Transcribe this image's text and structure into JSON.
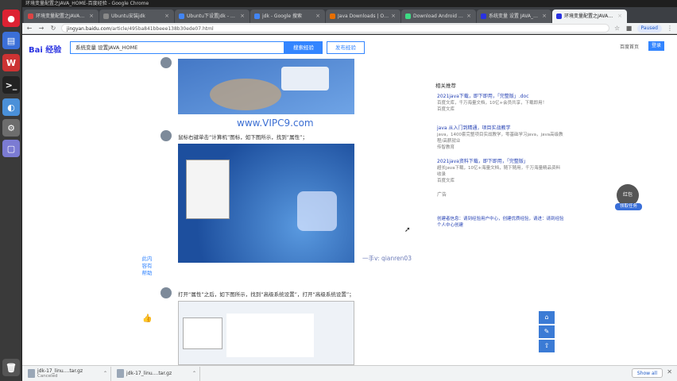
{
  "topbar": {
    "title": "环境变量配置之JAVA_HOME-百度经验 - Google Chrome",
    "clock": ""
  },
  "tabs": [
    {
      "label": "环境变量配置之JAVA_HOME-百度经验",
      "color": "#d44"
    },
    {
      "label": "Ubuntu安装jdk",
      "color": "#888"
    },
    {
      "label": "Ubuntu下设置jdk - Google",
      "color": "#4285f4"
    },
    {
      "label": "jdk - Google 搜索",
      "color": "#4285f4"
    },
    {
      "label": "Java Downloads | Oracle",
      "color": "#e76f00"
    },
    {
      "label": "Download Android Studio",
      "color": "#3ddc84"
    },
    {
      "label": "系统变量 设置 JAVA_HOME",
      "color": "#2932e1"
    },
    {
      "label": "环境变量配置之JAVA_HOME",
      "color": "#2932e1",
      "active": true
    }
  ],
  "address": {
    "host": "jingyan.baidu.com",
    "path": "/article/495ba841bbeee138b30ede07.html"
  },
  "paused_label": "Paused",
  "baidu": {
    "logo": "Bai 经验",
    "search_value": "系统变量 设置JAVA_HOME",
    "search_btn": "搜索经验",
    "publish_btn": "发布经验",
    "home_link": "百度首页",
    "login_btn": "登录"
  },
  "article": {
    "watermark": "www.VIPC9.com",
    "step2": "鼠标右键单击“计算机”图标，如下图所示，找到“属性”；",
    "step3": "打开“属性”之后，如下图所示，找到“高级系统设置”，打开“高级系统设置”；",
    "qq": "一手v: qianren03",
    "side_vertical": "此内容有帮助"
  },
  "sidebar": {
    "heading": "相关推荐",
    "recs": [
      {
        "title": "2021java下载，即下即用，「完整版」.doc",
        "desc": "百度文库，千万海量文档，10亿+会员共享，下载即用！",
        "foot": "百度文库"
      },
      {
        "title": "java 从入门到精通，项目实战教学",
        "desc": "java，1400套完整项目实战教学，零基础学习java，java高级教程/高薪就业",
        "foot": "传智教育"
      },
      {
        "title": "2021java资料下载，即下即用，「完整版」",
        "desc": "超长java下载，10亿+海量文档，随下随用，千万海量精品资料收录",
        "foot": "百度文库"
      }
    ],
    "ad_label": "广告",
    "feedback": "创建者信息：请到经验用户中心，创建优质经验，请进：请到经验个人中心创建"
  },
  "floats": {
    "helper": "红包",
    "task": "领取任务"
  },
  "downloads": [
    {
      "name": "jdk-17_linu....tar.gz",
      "status": "Canceled"
    },
    {
      "name": "jdk-17_linu....tar.gz",
      "status": ""
    }
  ],
  "show_all": "Show all"
}
